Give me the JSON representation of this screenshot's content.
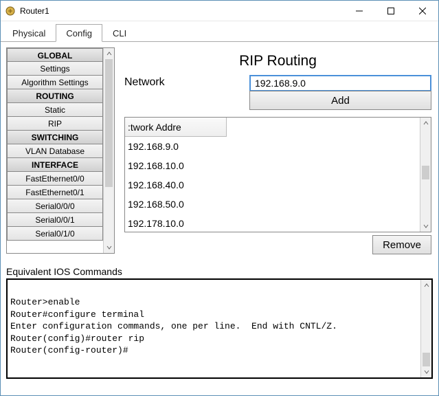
{
  "window": {
    "title": "Router1"
  },
  "tabs": [
    {
      "label": "Physical",
      "active": false
    },
    {
      "label": "Config",
      "active": true
    },
    {
      "label": "CLI",
      "active": false
    }
  ],
  "sidebar": {
    "items": [
      {
        "label": "GLOBAL",
        "header": true
      },
      {
        "label": "Settings"
      },
      {
        "label": "Algorithm Settings"
      },
      {
        "label": "ROUTING",
        "header": true
      },
      {
        "label": "Static"
      },
      {
        "label": "RIP"
      },
      {
        "label": "SWITCHING",
        "header": true
      },
      {
        "label": "VLAN Database"
      },
      {
        "label": "INTERFACE",
        "header": true
      },
      {
        "label": "FastEthernet0/0"
      },
      {
        "label": "FastEthernet0/1"
      },
      {
        "label": "Serial0/0/0"
      },
      {
        "label": "Serial0/0/1"
      },
      {
        "label": "Serial0/1/0"
      }
    ]
  },
  "main": {
    "title": "RIP Routing",
    "network_label": "Network",
    "network_value": "192.168.9.0",
    "add_label": "Add",
    "list_header": "Network Address",
    "list_header_cropped": ":twork Addre",
    "networks": [
      "192.168.9.0",
      "192.168.10.0",
      "192.168.40.0",
      "192.168.50.0",
      "192.178.10.0"
    ],
    "remove_label": "Remove"
  },
  "ios": {
    "label": "Equivalent IOS Commands",
    "lines": "Router>enable\nRouter#configure terminal\nEnter configuration commands, one per line.  End with CNTL/Z.\nRouter(config)#router rip\nRouter(config-router)#"
  }
}
